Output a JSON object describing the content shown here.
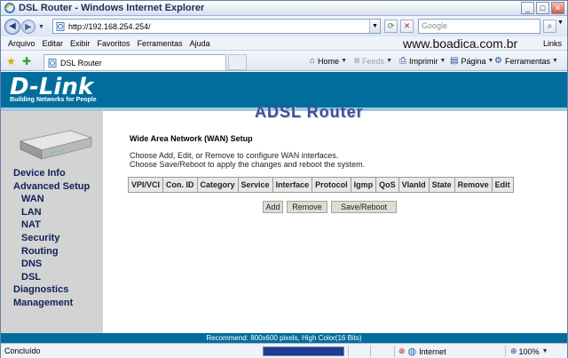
{
  "window": {
    "title": "DSL Router - Windows Internet Explorer",
    "minimize": "_",
    "maximize": "□",
    "close": "✕"
  },
  "address": {
    "url": "http://192.168.254.254/",
    "search_placeholder": "Google"
  },
  "menu": {
    "items": [
      "Arquivo",
      "Editar",
      "Exibir",
      "Favoritos",
      "Ferramentas",
      "Ajuda"
    ],
    "watermark": "www.boadica.com.br",
    "links": "Links"
  },
  "tab": {
    "label": "DSL Router"
  },
  "commands": {
    "home": "Home",
    "feeds": "Feeds",
    "print": "Imprimir",
    "page": "Página",
    "tools": "Ferramentas"
  },
  "banner": {
    "logo": "D-Link",
    "tagline": "Building Networks for People"
  },
  "sidebar": {
    "items": [
      {
        "label": "Device Info",
        "sub": false
      },
      {
        "label": "Advanced Setup",
        "sub": false
      },
      {
        "label": "WAN",
        "sub": true
      },
      {
        "label": "LAN",
        "sub": true
      },
      {
        "label": "NAT",
        "sub": true
      },
      {
        "label": "Security",
        "sub": true
      },
      {
        "label": "Routing",
        "sub": true
      },
      {
        "label": "DNS",
        "sub": true
      },
      {
        "label": "DSL",
        "sub": true
      },
      {
        "label": "Diagnostics",
        "sub": false
      },
      {
        "label": "Management",
        "sub": false
      }
    ]
  },
  "content": {
    "heading": "ADSL Router",
    "section_title": "Wide Area Network (WAN) Setup",
    "desc_line1": "Choose Add, Edit, or Remove to configure WAN interfaces.",
    "desc_line2": "Choose Save/Reboot to apply the changes and reboot the system.",
    "table_headers": [
      "VPI/VCI",
      "Con. ID",
      "Category",
      "Service",
      "Interface",
      "Protocol",
      "Igmp",
      "QoS",
      "VlanId",
      "State",
      "Remove",
      "Edit"
    ],
    "buttons": {
      "add": "Add",
      "remove": "Remove",
      "save_reboot": "Save/Reboot"
    },
    "recommend": "Recommend: 800x600 pixels, High Color(16 Bits)"
  },
  "status": {
    "text": "Concluído",
    "progress": 1.0,
    "zone": "Internet",
    "zoom": "100%"
  },
  "colors": {
    "banner": "#006d9c",
    "sidebar": "#d3d3d3",
    "nav_text": "#10205a",
    "heading": "#3c4f98"
  }
}
